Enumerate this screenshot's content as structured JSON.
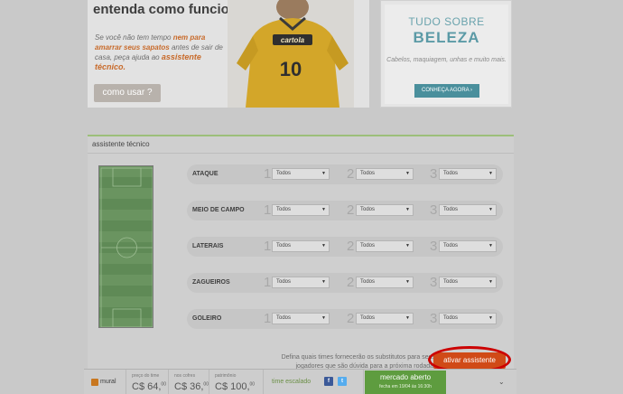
{
  "promo": {
    "title": "entenda como funciona",
    "text_plain1": "Se você não tem tempo ",
    "text_bold1": "nem para amarrar seus sapatos",
    "text_plain2": " antes de sair de casa, peça ajuda ao ",
    "text_big": "assistente técnico.",
    "button": "como usar ?",
    "jersey_brand": "cartola",
    "jersey_number": "10"
  },
  "ad": {
    "line1": "TUDO SOBRE",
    "line2": "BELEZA",
    "line3": "Cabelos, maquiagem, unhas e muito mais.",
    "button": "CONHEÇA AGORA ›"
  },
  "assistant": {
    "title": "assistente técnico",
    "rows": [
      {
        "label": "ATAQUE",
        "options": [
          "Todos",
          "Todos",
          "Todos"
        ]
      },
      {
        "label": "MEIO DE CAMPO",
        "options": [
          "Todos",
          "Todos",
          "Todos"
        ]
      },
      {
        "label": "LATERAIS",
        "options": [
          "Todos",
          "Todos",
          "Todos"
        ]
      },
      {
        "label": "ZAGUEIROS",
        "options": [
          "Todos",
          "Todos",
          "Todos"
        ]
      },
      {
        "label": "GOLEIRO",
        "options": [
          "Todos",
          "Todos",
          "Todos"
        ]
      }
    ],
    "priorities": [
      "1",
      "2",
      "3"
    ],
    "note": "Defina quais times fornecerão os substitutos para seus jogadores que são dúvida para a próxima rodada.",
    "activate_button": "ativar assistente"
  },
  "bottombar": {
    "mural": "mural",
    "price_label": "preço do time",
    "price_value": "C$ 64,",
    "price_cents": "00",
    "safe_label": "nos cofres",
    "safe_value": "C$ 36,",
    "safe_cents": "00",
    "equity_label": "patrimônio",
    "equity_value": "C$ 100,",
    "equity_cents": "00",
    "team_status": "time escalado",
    "facebook_glyph": "f",
    "twitter_glyph": "t",
    "market_line1": "mercado aberto",
    "market_line2": "fecha em 19/04 às 16:30h",
    "chevron": "⌄"
  },
  "colors": {
    "accent_orange": "#d04a17",
    "field_green": "#5f8a56",
    "market_green": "#5e9c3f",
    "ad_teal": "#4a8f9c",
    "highlight_ring": "#cc0000"
  }
}
